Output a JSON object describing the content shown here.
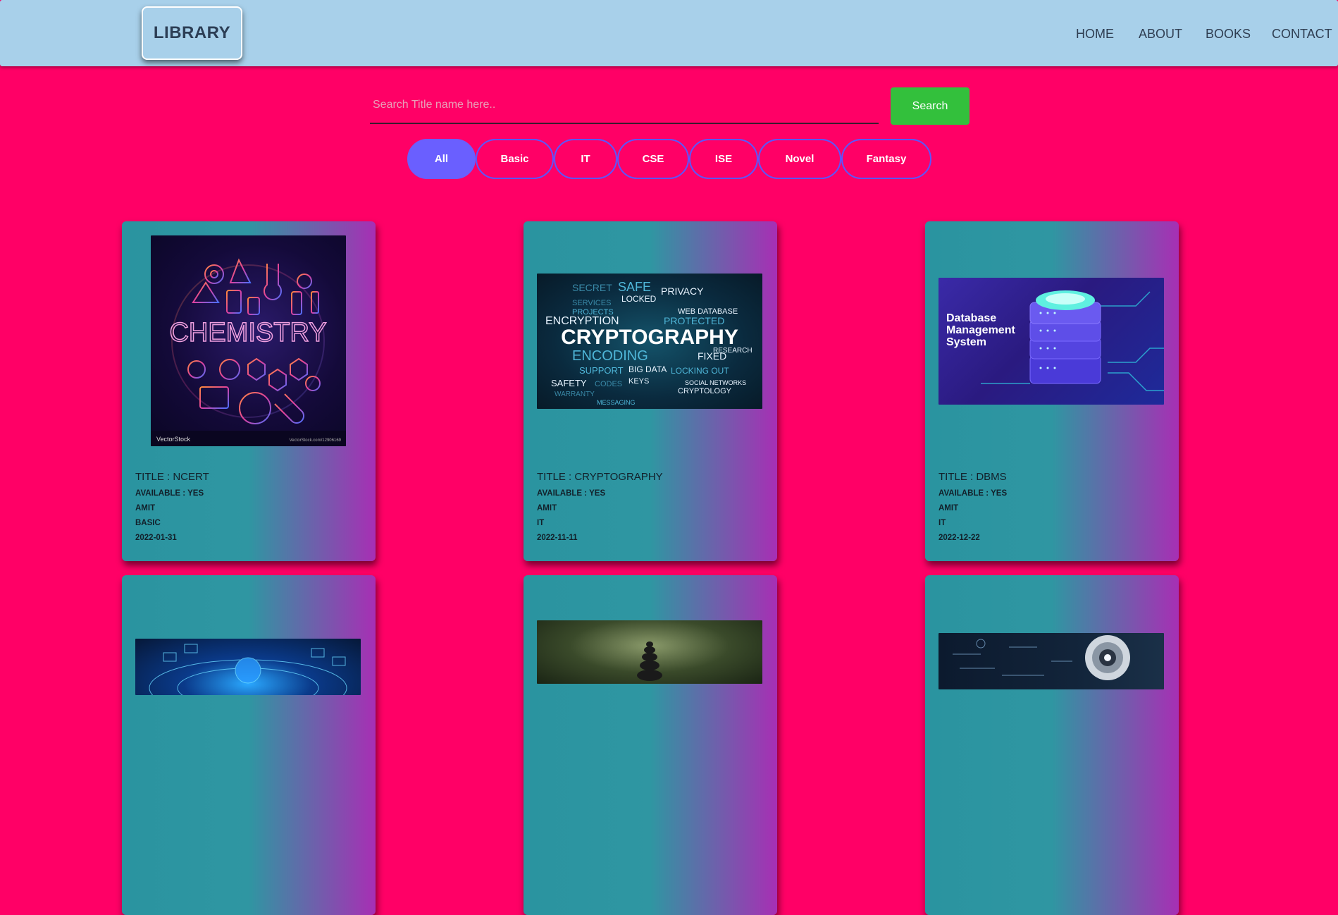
{
  "nav": {
    "logo": "LIBRARY",
    "links": [
      "HOME",
      "ABOUT",
      "BOOKS",
      "CONTACT"
    ]
  },
  "search": {
    "placeholder": "Search Title name here..",
    "value": "",
    "button_label": "Search"
  },
  "filters": {
    "items": [
      "All",
      "Basic",
      "IT",
      "CSE",
      "ISE",
      "Novel",
      "Fantasy"
    ],
    "active": "All"
  },
  "books": [
    {
      "title": "TITLE : NCERT",
      "available": "AVAILABLE : YES",
      "author": "AMIT",
      "category": "BASIC",
      "date": "2022-01-31",
      "image_label": "CHEMISTRY",
      "image_credit": "VectorStock",
      "image_credit_url": "VectorStock.com/12906169"
    },
    {
      "title": "TITLE : CRYPTOGRAPHY",
      "available": "AVAILABLE : YES",
      "author": "AMIT",
      "category": "IT",
      "date": "2022-11-11",
      "image_label": "CRYPTOGRAPHY",
      "image_words": [
        "SECRET",
        "SAFE",
        "PRIVACY",
        "LOCKED",
        "ENCRYPTION",
        "PROTECTED",
        "ENCODING",
        "FIXED",
        "SUPPORT",
        "SAFETY",
        "CODES",
        "WARRANTY",
        "MESSAGING",
        "CRYPTOLOGY",
        "WEB DATABASE",
        "RESEARCH",
        "BIG DATA",
        "KEYS",
        "LOCKING OUT",
        "SOCIAL NETWORKS",
        "PROJECTS",
        "SERVICES"
      ]
    },
    {
      "title": "TITLE : DBMS",
      "available": "AVAILABLE : YES",
      "author": "AMIT",
      "category": "IT",
      "date": "2022-12-22",
      "image_lines": [
        "Database",
        "Management",
        "System"
      ]
    }
  ]
}
